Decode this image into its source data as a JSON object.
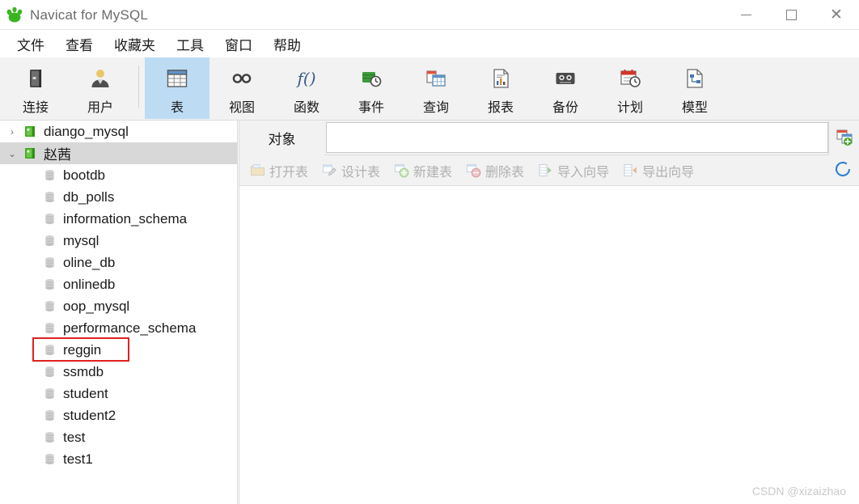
{
  "window": {
    "title": "Navicat for MySQL",
    "logo_icon": "navicat-paw-logo",
    "controls": {
      "minimize_label": "—",
      "maximize_label": "□",
      "close_label": "✕"
    }
  },
  "menubar": {
    "items": [
      {
        "label": "文件"
      },
      {
        "label": "查看"
      },
      {
        "label": "收藏夹"
      },
      {
        "label": "工具"
      },
      {
        "label": "窗口"
      },
      {
        "label": "帮助"
      }
    ]
  },
  "toolbar": {
    "groups": [
      {
        "buttons": [
          {
            "label": "连接",
            "icon": "connection-icon",
            "active": false
          },
          {
            "label": "用户",
            "icon": "user-icon",
            "active": false
          }
        ]
      },
      {
        "buttons": [
          {
            "label": "表",
            "icon": "table-grid-icon",
            "active": true
          },
          {
            "label": "视图",
            "icon": "view-glasses-icon",
            "active": false
          },
          {
            "label": "函数",
            "icon": "function-fx-icon",
            "active": false
          },
          {
            "label": "事件",
            "icon": "event-clock-icon",
            "active": false
          },
          {
            "label": "查询",
            "icon": "query-icon",
            "active": false
          },
          {
            "label": "报表",
            "icon": "report-icon",
            "active": false
          },
          {
            "label": "备份",
            "icon": "backup-icon",
            "active": false
          },
          {
            "label": "计划",
            "icon": "schedule-calendar-icon",
            "active": false
          },
          {
            "label": "模型",
            "icon": "model-icon",
            "active": false
          }
        ]
      }
    ]
  },
  "sidebar": {
    "connections": [
      {
        "label": "diango_mysql",
        "icon": "server-connection-icon",
        "expanded": false,
        "selected": false,
        "twisty": "›"
      },
      {
        "label": "赵茜",
        "icon": "server-connection-icon",
        "expanded": true,
        "selected": true,
        "twisty": "⌄"
      }
    ],
    "databases": [
      {
        "label": "bootdb",
        "icon": "database-icon",
        "highlighted": false
      },
      {
        "label": "db_polls",
        "icon": "database-icon",
        "highlighted": false
      },
      {
        "label": "information_schema",
        "icon": "database-icon",
        "highlighted": false
      },
      {
        "label": "mysql",
        "icon": "database-icon",
        "highlighted": false
      },
      {
        "label": "oline_db",
        "icon": "database-icon",
        "highlighted": false
      },
      {
        "label": "onlinedb",
        "icon": "database-icon",
        "highlighted": false
      },
      {
        "label": "oop_mysql",
        "icon": "database-icon",
        "highlighted": false
      },
      {
        "label": "performance_schema",
        "icon": "database-icon",
        "highlighted": false
      },
      {
        "label": "reggin",
        "icon": "database-icon",
        "highlighted": true
      },
      {
        "label": "ssmdb",
        "icon": "database-icon",
        "highlighted": false
      },
      {
        "label": "student",
        "icon": "database-icon",
        "highlighted": false
      },
      {
        "label": "student2",
        "icon": "database-icon",
        "highlighted": false
      },
      {
        "label": "test",
        "icon": "database-icon",
        "highlighted": false
      },
      {
        "label": "test1",
        "icon": "database-icon",
        "highlighted": false
      }
    ],
    "annotation": {
      "target": "reggin",
      "color": "#e02020"
    }
  },
  "right_panel": {
    "tab": {
      "label": "对象",
      "active": true
    },
    "search": {
      "value": "",
      "placeholder": ""
    },
    "add_tab_icon": "new-object-tab-icon",
    "object_toolbar": {
      "buttons": [
        {
          "label": "打开表",
          "icon": "open-table-icon"
        },
        {
          "label": "设计表",
          "icon": "design-table-pencil-icon"
        },
        {
          "label": "新建表",
          "icon": "new-table-plus-icon"
        },
        {
          "label": "删除表",
          "icon": "delete-table-minus-icon"
        },
        {
          "label": "导入向导",
          "icon": "import-wizard-icon"
        },
        {
          "label": "导出向导",
          "icon": "export-wizard-icon"
        }
      ],
      "refresh_icon": "refresh-circle-icon"
    }
  },
  "watermark": {
    "text": "CSDN @xizaizhao"
  },
  "colors": {
    "active_toolbar_button": "#bddcf4",
    "selected_tree_row": "#d8d8d8",
    "toolbar_background": "#f2f2f2",
    "annotation_red": "#e02020",
    "logo_green": "#35a818",
    "disabled_text": "#b0b0b0"
  }
}
